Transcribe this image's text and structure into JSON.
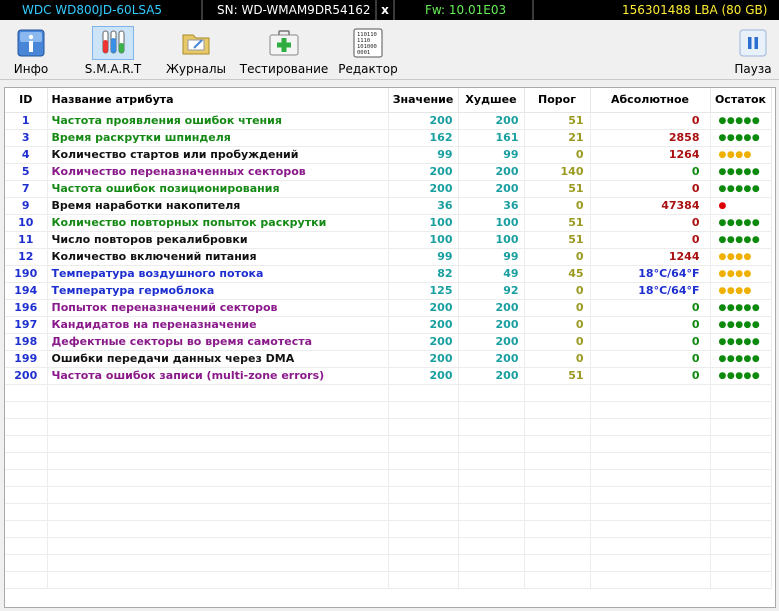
{
  "status_bar": {
    "model": "WDC WD800JD-60LSA5",
    "serial": "SN: WD-WMAM9DR54162",
    "close": "x",
    "firmware": "Fw: 10.01E03",
    "capacity": "156301488 LBA (80 GB)"
  },
  "toolbar": {
    "info": "Инфо",
    "smart": "S.M.A.R.T",
    "logs": "Журналы",
    "test": "Тестирование",
    "editor": "Редактор",
    "pause": "Пауза",
    "editor_icon_text": "110110\n1110\n101000\n0001"
  },
  "table": {
    "headers": {
      "id": "ID",
      "name": "Название атрибута",
      "value": "Значение",
      "worst": "Худшее",
      "threshold": "Порог",
      "absolute": "Абсолютное",
      "remaining": "Остаток"
    },
    "rows": [
      {
        "id": "1",
        "name": "Частота проявления ошибок чтения",
        "value": "200",
        "worst": "200",
        "threshold": "51",
        "absolute": "0",
        "dots": "●●●●●"
      },
      {
        "id": "3",
        "name": "Время раскрутки шпинделя",
        "value": "162",
        "worst": "161",
        "threshold": "21",
        "absolute": "2858",
        "dots": "●●●●●"
      },
      {
        "id": "4",
        "name": "Количество стартов или пробуждений",
        "value": "99",
        "worst": "99",
        "threshold": "0",
        "absolute": "1264",
        "dots": "●●●●"
      },
      {
        "id": "5",
        "name": "Количество переназначенных секторов",
        "value": "200",
        "worst": "200",
        "threshold": "140",
        "absolute": "0",
        "dots": "●●●●●"
      },
      {
        "id": "7",
        "name": "Частота ошибок позиционирования",
        "value": "200",
        "worst": "200",
        "threshold": "51",
        "absolute": "0",
        "dots": "●●●●●"
      },
      {
        "id": "9",
        "name": "Время наработки накопителя",
        "value": "36",
        "worst": "36",
        "threshold": "0",
        "absolute": "47384",
        "dots": "●"
      },
      {
        "id": "10",
        "name": "Количество повторных попыток раскрутки",
        "value": "100",
        "worst": "100",
        "threshold": "51",
        "absolute": "0",
        "dots": "●●●●●"
      },
      {
        "id": "11",
        "name": "Число повторов рекалибровки",
        "value": "100",
        "worst": "100",
        "threshold": "51",
        "absolute": "0",
        "dots": "●●●●●"
      },
      {
        "id": "12",
        "name": "Количество включений питания",
        "value": "99",
        "worst": "99",
        "threshold": "0",
        "absolute": "1244",
        "dots": "●●●●"
      },
      {
        "id": "190",
        "name": "Температура воздушного потока",
        "value": "82",
        "worst": "49",
        "threshold": "45",
        "absolute": "18°C/64°F",
        "dots": "●●●●"
      },
      {
        "id": "194",
        "name": "Температура гермоблока",
        "value": "125",
        "worst": "92",
        "threshold": "0",
        "absolute": "18°C/64°F",
        "dots": "●●●●"
      },
      {
        "id": "196",
        "name": "Попыток переназначений секторов",
        "value": "200",
        "worst": "200",
        "threshold": "0",
        "absolute": "0",
        "dots": "●●●●●"
      },
      {
        "id": "197",
        "name": "Кандидатов на переназначение",
        "value": "200",
        "worst": "200",
        "threshold": "0",
        "absolute": "0",
        "dots": "●●●●●"
      },
      {
        "id": "198",
        "name": "Дефектные секторы во время самотеста",
        "value": "200",
        "worst": "200",
        "threshold": "0",
        "absolute": "0",
        "dots": "●●●●●"
      },
      {
        "id": "199",
        "name": "Ошибки передачи данных через DMA",
        "value": "200",
        "worst": "200",
        "threshold": "0",
        "absolute": "0",
        "dots": "●●●●●"
      },
      {
        "id": "200",
        "name": "Частота ошибок записи (multi-zone errors)",
        "value": "200",
        "worst": "200",
        "threshold": "51",
        "absolute": "0",
        "dots": "●●●●●"
      }
    ]
  }
}
